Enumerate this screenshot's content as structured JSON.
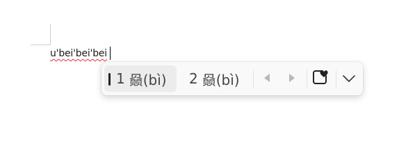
{
  "document": {
    "typed_text": "u'bei'bei'bei"
  },
  "ime": {
    "candidates": [
      {
        "number": "1",
        "text": "赑(bì)",
        "selected": true
      },
      {
        "number": "2",
        "text": "赑(bì)",
        "selected": false
      }
    ],
    "controls": {
      "prev_page_icon": "triangle-left-icon",
      "next_page_icon": "triangle-right-icon",
      "favorite_icon": "heart-box-icon",
      "expand_icon": "chevron-down-icon"
    },
    "colors": {
      "bar_background": "#f9f9f9",
      "selected_background": "#ececec",
      "disabled_arrow": "#b8b8b8",
      "text": "#444444"
    }
  }
}
